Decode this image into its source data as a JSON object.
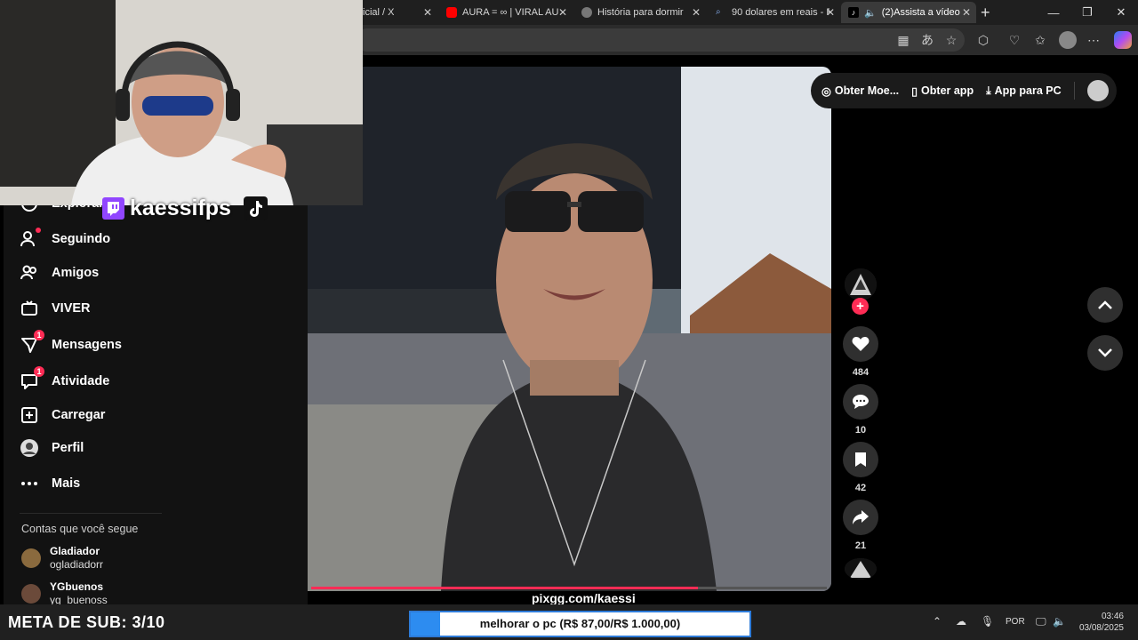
{
  "browser": {
    "tabs": [
      {
        "title": "icial / X",
        "favicon_color": "#1f1f1f",
        "active": false
      },
      {
        "title": "AURA = ∞ | VIRAL AU",
        "favicon_color": "#ff0000",
        "active": false
      },
      {
        "title": "História para dormir",
        "favicon_color": "#888888",
        "active": false
      },
      {
        "title": "90 dolares em reais - F",
        "favicon_color": "#4a6fa5",
        "active": false
      },
      {
        "title": "(2)Assista a vídeo",
        "favicon_color": "#111111",
        "active": true
      }
    ],
    "new_tab_label": "+",
    "minimize": "—",
    "maximize": "❐",
    "close": "✕"
  },
  "stream": {
    "channel_name": "kaessifps",
    "pix_text": "pixgg.com/kaessi"
  },
  "sidebar": {
    "items": [
      {
        "label": "Explorar",
        "icon": "compass-icon"
      },
      {
        "label": "Seguindo",
        "icon": "following-icon"
      },
      {
        "label": "Amigos",
        "icon": "friends-icon"
      },
      {
        "label": "VIVER",
        "icon": "live-icon"
      },
      {
        "label": "Mensagens",
        "icon": "messages-icon",
        "badge": "1"
      },
      {
        "label": "Atividade",
        "icon": "activity-icon",
        "badge": "1"
      },
      {
        "label": "Carregar",
        "icon": "upload-icon"
      },
      {
        "label": "Perfil",
        "icon": "profile-avatar"
      },
      {
        "label": "Mais",
        "icon": "more-icon"
      }
    ],
    "following_heading": "Contas que você segue",
    "accounts": [
      {
        "name": "Gladiador",
        "username": "ogladiadorr"
      },
      {
        "name": "YGbuenos",
        "username": "yg_buenoss"
      }
    ]
  },
  "topbar": {
    "coins": "Obter Moe...",
    "get_app": "Obter app",
    "pc_app": "App para PC"
  },
  "actions": {
    "likes": "484",
    "comments": "10",
    "saves": "42",
    "shares": "21"
  },
  "video_progress": 0.75,
  "overlay": {
    "sub_goal": "META DE SUB: 3/10",
    "goal_text": "melhorar o pc (R$ 87,00/R$ 1.000,00)",
    "goal_progress": 0.087
  },
  "taskbar": {
    "language": "POR",
    "time": "03:46",
    "date": "03/08/2025"
  }
}
